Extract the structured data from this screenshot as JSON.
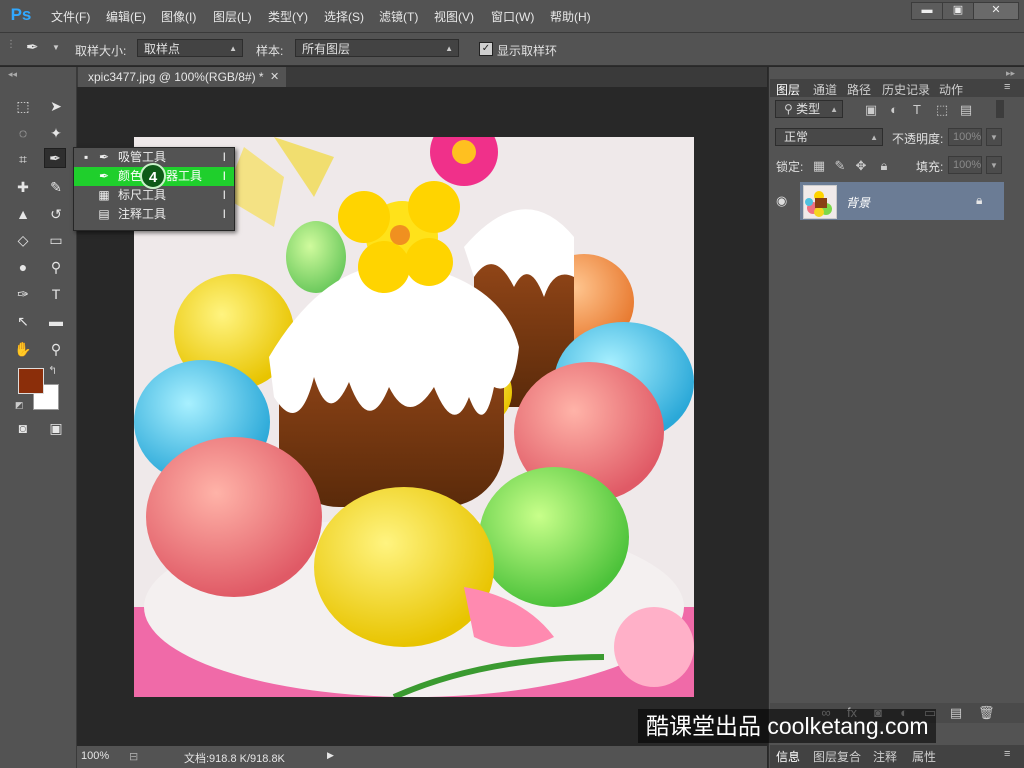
{
  "app": {
    "logo": "Ps"
  },
  "menubar": {
    "items": [
      "文件(F)",
      "编辑(E)",
      "图像(I)",
      "图层(L)",
      "类型(Y)",
      "选择(S)",
      "滤镜(T)",
      "视图(V)",
      "窗口(W)",
      "帮助(H)"
    ],
    "window_buttons": {
      "minimize": "▬",
      "maximize": "▣",
      "close": "✕"
    }
  },
  "options": {
    "sample_size_label": "取样大小:",
    "sample_size_value": "取样点",
    "sample_label": "样本:",
    "sample_value": "所有图层",
    "show_ring_label": "显示取样环",
    "show_ring_checked": true
  },
  "document": {
    "tab_title": "xpic3477.jpg @ 100%(RGB/8#) *",
    "zoom": "100%",
    "doc_info": "文档:918.8 K/918.8K"
  },
  "colors": {
    "foreground": "#8b2e0a",
    "background": "#ffffff",
    "flyout_highlight": "#1fcf2c"
  },
  "tool_flyout": {
    "items": [
      {
        "label": "吸管工具",
        "shortcut": "I",
        "icon": "eyedropper-icon",
        "selected": true
      },
      {
        "label": "颜色取样器工具",
        "shortcut": "I",
        "icon": "color-sampler-icon",
        "highlighted": true
      },
      {
        "label": "标尺工具",
        "shortcut": "I",
        "icon": "ruler-icon"
      },
      {
        "label": "注释工具",
        "shortcut": "I",
        "icon": "note-icon"
      }
    ],
    "step_badge": "4"
  },
  "layers_panel": {
    "tabs": [
      "图层",
      "通道",
      "路径",
      "历史记录",
      "动作"
    ],
    "filter_kind": "类型",
    "blend_mode": "正常",
    "opacity_label": "不透明度:",
    "opacity_value": "100%",
    "lock_label": "锁定:",
    "fill_label": "填充:",
    "fill_value": "100%",
    "layer_name": "背景"
  },
  "bottom_panel": {
    "tabs": [
      "信息",
      "图层复合",
      "注释",
      "属性"
    ]
  },
  "watermark": "酷课堂出品 coolketang.com"
}
